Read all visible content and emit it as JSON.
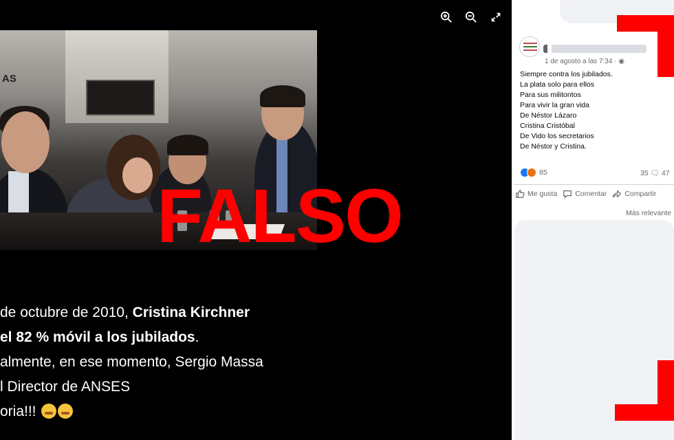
{
  "viewer": {
    "controls": {
      "zoom_in": "zoom-in-icon",
      "zoom_out": "zoom-out-icon",
      "fullscreen": "expand-icon"
    },
    "image": {
      "photo_sign_text": "AS",
      "overlay_label": "FALSO",
      "overlay_color": "#ff0000"
    },
    "caption": {
      "line1_plain": " de octubre de 2010, ",
      "line1_bold": "Cristina Kirchner",
      "line2_bold": "el 82 % móvil a los jubilados",
      "line2_plain": ".",
      "line3": "almente, en ese momento, Sergio Massa",
      "line4": "l Director de ANSES",
      "line5": "oria!!!"
    }
  },
  "post": {
    "date": "1 de agosto a las 7:34 · ",
    "text_lines": [
      "Siempre contra los jubilados.",
      "La plata solo para ellos",
      "Para sus militontos",
      "Para vivir la gran vida",
      "De Néstor Lázaro",
      "Cristina Cristóbal",
      "De Vido los secretarios",
      "De Néstor y Cristina."
    ],
    "reactions_count": "85",
    "comments_count": "35",
    "shares_count": "47",
    "actions": {
      "like": "Me gusta",
      "comment": "Comentar",
      "share": "Compartir"
    },
    "sort_label": "Más relevante"
  },
  "colors": {
    "accent_red": "#ff0000",
    "like_blue": "#1877f2",
    "muted_text": "#65676b"
  }
}
